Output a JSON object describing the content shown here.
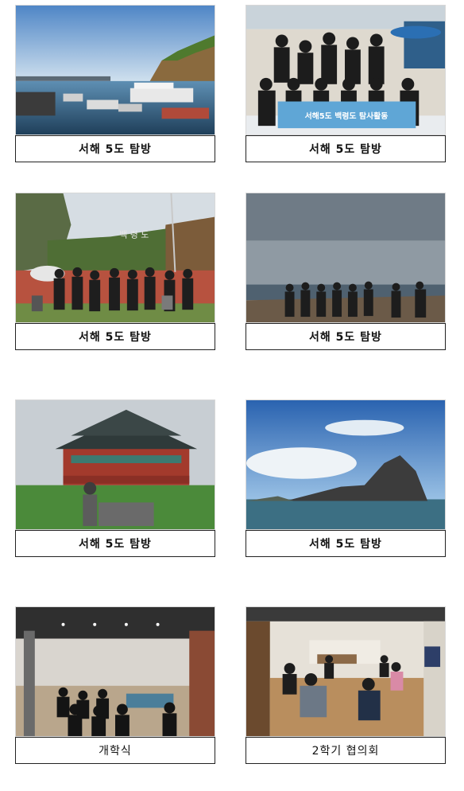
{
  "photos": [
    {
      "caption": "서해 5도 탐방"
    },
    {
      "caption": "서해 5도 탐방",
      "banner": "서해5도 백령도 탐사활동"
    },
    {
      "caption": "서해 5도 탐방",
      "sign": "백 령 도"
    },
    {
      "caption": "서해 5도 탐방"
    },
    {
      "caption": "서해 5도 탐방"
    },
    {
      "caption": "서해 5도 탐방"
    },
    {
      "caption": "개학식"
    },
    {
      "caption": "2학기 협의회"
    }
  ]
}
